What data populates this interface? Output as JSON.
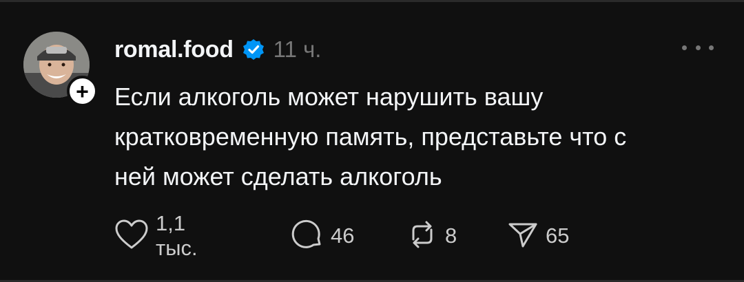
{
  "post": {
    "username": "romal.food",
    "verified": true,
    "time": "11 ч.",
    "text": "Если алкоголь может нарушить вашу\nкратковременную память, представьте что с\nней может сделать алкоголь"
  },
  "actions": {
    "likes": "1,1 тыс.",
    "replies": "46",
    "reposts": "8",
    "shares": "65"
  },
  "icons": {
    "like": "heart-icon",
    "reply": "comment-icon",
    "repost": "repost-icon",
    "share": "send-icon",
    "more": "more-icon",
    "verified": "verified-badge-icon",
    "follow": "plus-icon"
  },
  "colors": {
    "background": "#101010",
    "text": "#f3f5f7",
    "muted": "#777777",
    "verified": "#0095f6"
  }
}
